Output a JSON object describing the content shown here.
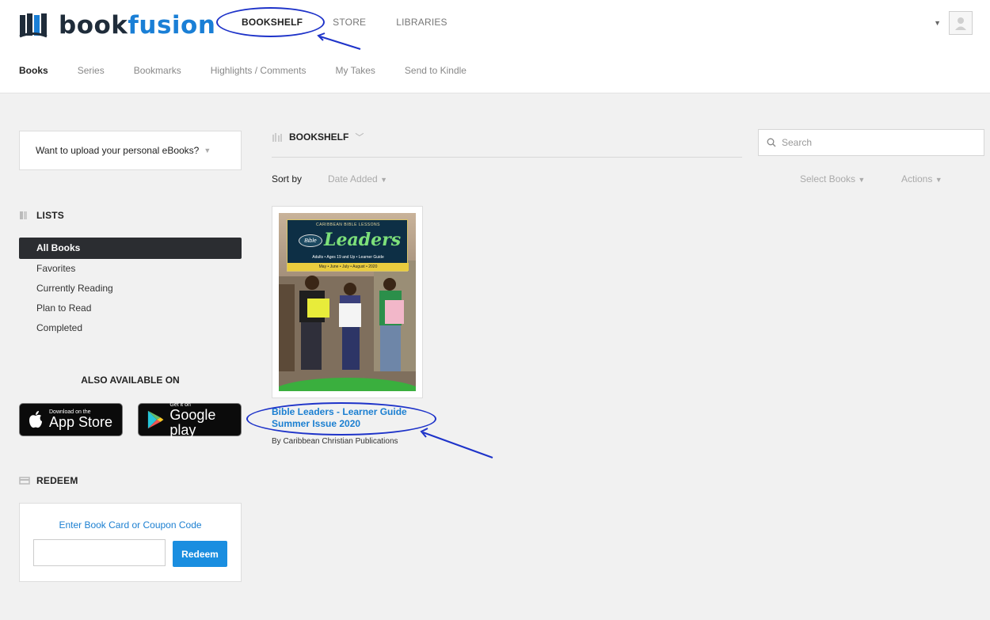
{
  "brand": {
    "name_dark": "book",
    "name_accent": "fusion"
  },
  "mainnav": [
    "BOOKSHELF",
    "STORE",
    "LIBRARIES"
  ],
  "subnav": [
    "Books",
    "Series",
    "Bookmarks",
    "Highlights / Comments",
    "My Takes",
    "Send to Kindle"
  ],
  "sidebar": {
    "upload_prompt": "Want to upload your personal eBooks?",
    "lists_heading": "LISTS",
    "lists": [
      "All Books",
      "Favorites",
      "Currently Reading",
      "Plan to Read",
      "Completed"
    ],
    "also_available": "ALSO AVAILABLE ON",
    "appstore": {
      "small": "Download on the",
      "big": "App Store"
    },
    "googleplay": {
      "small": "Get it on",
      "big": "Google play"
    },
    "redeem_heading": "REDEEM",
    "redeem_title": "Enter Book Card or Coupon Code",
    "redeem_button": "Redeem",
    "redeem_value": ""
  },
  "main": {
    "shelf_label": "BOOKSHELF",
    "search_placeholder": "Search",
    "sort_label": "Sort by",
    "sort_value": "Date Added",
    "select_books": "Select Books",
    "actions": "Actions",
    "book": {
      "cover_top": "CARIBBEAN BIBLE LESSONS",
      "cover_bible": "Bible",
      "cover_title": "Leaders",
      "cover_sub": "Adults • Ages 19 and Up • Learner Guide",
      "cover_strip": "May • June • July • August • 2020",
      "title_line1": "Bible Leaders - Learner Guide",
      "title_line2": "Summer Issue 2020",
      "author": "By Caribbean Christian Publications"
    }
  },
  "colors": {
    "accent": "#1a7fd6",
    "annotation": "#1e33c9",
    "button": "#1a8ee0"
  }
}
